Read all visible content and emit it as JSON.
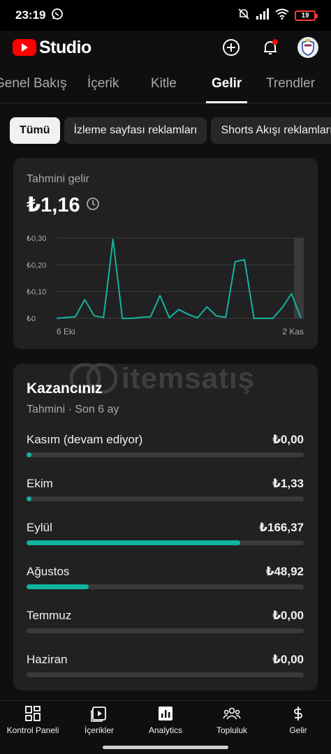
{
  "status_bar": {
    "time": "23:19",
    "battery": "19"
  },
  "app": {
    "logo_text": "Studio"
  },
  "tabs": [
    {
      "label": "Genel Bakış"
    },
    {
      "label": "İçerik"
    },
    {
      "label": "Kitle"
    },
    {
      "label": "Gelir"
    },
    {
      "label": "Trendler"
    }
  ],
  "active_tab": "Gelir",
  "chips": [
    {
      "label": "Tümü",
      "selected": true
    },
    {
      "label": "İzleme sayfası reklamları"
    },
    {
      "label": "Shorts Akışı reklamları"
    }
  ],
  "revenue_card": {
    "label": "Tahmini gelir",
    "value": "₺1,16",
    "chart_data": {
      "type": "line",
      "x_start": "6 Eki",
      "x_end": "2 Kas",
      "x_labels": [
        "6 Eki",
        "2 Kas"
      ],
      "y_ticks": [
        "₺0",
        "₺0,10",
        "₺0,20",
        "₺0,30"
      ],
      "ylim": [
        0,
        0.3
      ],
      "values": [
        0.0,
        0.003,
        0.006,
        0.07,
        0.01,
        0.003,
        0.295,
        0.0,
        0.0,
        0.004,
        0.006,
        0.085,
        0.002,
        0.033,
        0.015,
        0.002,
        0.043,
        0.009,
        0.004,
        0.212,
        0.219,
        0.0,
        0.0,
        0.0,
        0.04,
        0.092,
        0.0
      ],
      "color": "#12b3a0",
      "grid": true
    }
  },
  "earnings": {
    "title": "Kazancınız",
    "subtitle": "Tahmini · Son 6 ay",
    "accent": "#12b3a0",
    "rows": [
      {
        "month": "Kasım (devam ediyor)",
        "value": "₺0,00",
        "fraction": 0.0,
        "dot": true
      },
      {
        "month": "Ekim",
        "value": "₺1,33",
        "fraction": 0.008,
        "dot": true
      },
      {
        "month": "Eylül",
        "value": "₺166,37",
        "fraction": 0.77
      },
      {
        "month": "Ağustos",
        "value": "₺48,92",
        "fraction": 0.225
      },
      {
        "month": "Temmuz",
        "value": "₺0,00",
        "fraction": 0.0
      },
      {
        "month": "Haziran",
        "value": "₺0,00",
        "fraction": 0.0
      }
    ]
  },
  "watermark": {
    "text": "itemsatış"
  },
  "bottom_nav": [
    {
      "label": "Kontrol Paneli",
      "icon": "dashboard-icon"
    },
    {
      "label": "İçerikler",
      "icon": "content-icon"
    },
    {
      "label": "Analytics",
      "icon": "analytics-icon"
    },
    {
      "label": "Topluluk",
      "icon": "community-icon"
    },
    {
      "label": "Gelir",
      "icon": "earn-icon"
    }
  ]
}
